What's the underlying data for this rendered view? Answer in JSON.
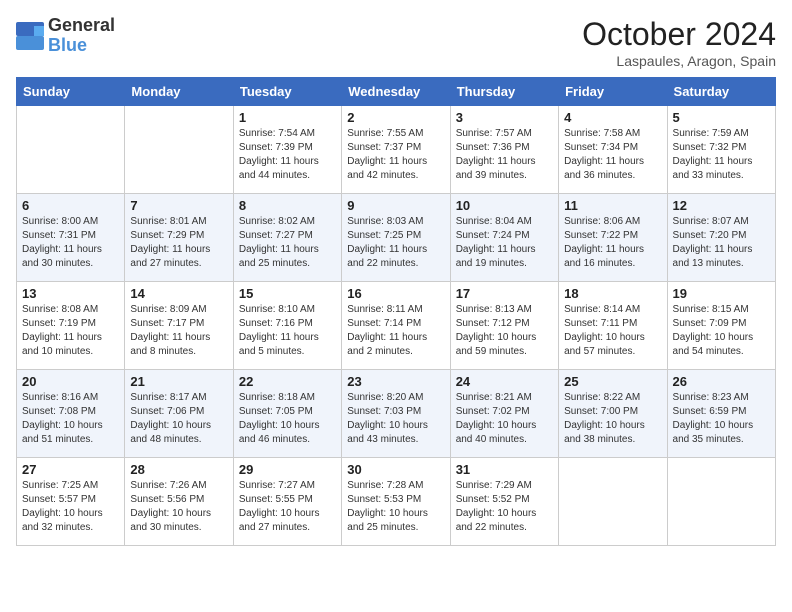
{
  "logo": {
    "general": "General",
    "blue": "Blue"
  },
  "title": "October 2024",
  "location": "Laspaules, Aragon, Spain",
  "days_header": [
    "Sunday",
    "Monday",
    "Tuesday",
    "Wednesday",
    "Thursday",
    "Friday",
    "Saturday"
  ],
  "weeks": [
    [
      {
        "day": "",
        "sunrise": "",
        "sunset": "",
        "daylight": ""
      },
      {
        "day": "",
        "sunrise": "",
        "sunset": "",
        "daylight": ""
      },
      {
        "day": "1",
        "sunrise": "Sunrise: 7:54 AM",
        "sunset": "Sunset: 7:39 PM",
        "daylight": "Daylight: 11 hours and 44 minutes."
      },
      {
        "day": "2",
        "sunrise": "Sunrise: 7:55 AM",
        "sunset": "Sunset: 7:37 PM",
        "daylight": "Daylight: 11 hours and 42 minutes."
      },
      {
        "day": "3",
        "sunrise": "Sunrise: 7:57 AM",
        "sunset": "Sunset: 7:36 PM",
        "daylight": "Daylight: 11 hours and 39 minutes."
      },
      {
        "day": "4",
        "sunrise": "Sunrise: 7:58 AM",
        "sunset": "Sunset: 7:34 PM",
        "daylight": "Daylight: 11 hours and 36 minutes."
      },
      {
        "day": "5",
        "sunrise": "Sunrise: 7:59 AM",
        "sunset": "Sunset: 7:32 PM",
        "daylight": "Daylight: 11 hours and 33 minutes."
      }
    ],
    [
      {
        "day": "6",
        "sunrise": "Sunrise: 8:00 AM",
        "sunset": "Sunset: 7:31 PM",
        "daylight": "Daylight: 11 hours and 30 minutes."
      },
      {
        "day": "7",
        "sunrise": "Sunrise: 8:01 AM",
        "sunset": "Sunset: 7:29 PM",
        "daylight": "Daylight: 11 hours and 27 minutes."
      },
      {
        "day": "8",
        "sunrise": "Sunrise: 8:02 AM",
        "sunset": "Sunset: 7:27 PM",
        "daylight": "Daylight: 11 hours and 25 minutes."
      },
      {
        "day": "9",
        "sunrise": "Sunrise: 8:03 AM",
        "sunset": "Sunset: 7:25 PM",
        "daylight": "Daylight: 11 hours and 22 minutes."
      },
      {
        "day": "10",
        "sunrise": "Sunrise: 8:04 AM",
        "sunset": "Sunset: 7:24 PM",
        "daylight": "Daylight: 11 hours and 19 minutes."
      },
      {
        "day": "11",
        "sunrise": "Sunrise: 8:06 AM",
        "sunset": "Sunset: 7:22 PM",
        "daylight": "Daylight: 11 hours and 16 minutes."
      },
      {
        "day": "12",
        "sunrise": "Sunrise: 8:07 AM",
        "sunset": "Sunset: 7:20 PM",
        "daylight": "Daylight: 11 hours and 13 minutes."
      }
    ],
    [
      {
        "day": "13",
        "sunrise": "Sunrise: 8:08 AM",
        "sunset": "Sunset: 7:19 PM",
        "daylight": "Daylight: 11 hours and 10 minutes."
      },
      {
        "day": "14",
        "sunrise": "Sunrise: 8:09 AM",
        "sunset": "Sunset: 7:17 PM",
        "daylight": "Daylight: 11 hours and 8 minutes."
      },
      {
        "day": "15",
        "sunrise": "Sunrise: 8:10 AM",
        "sunset": "Sunset: 7:16 PM",
        "daylight": "Daylight: 11 hours and 5 minutes."
      },
      {
        "day": "16",
        "sunrise": "Sunrise: 8:11 AM",
        "sunset": "Sunset: 7:14 PM",
        "daylight": "Daylight: 11 hours and 2 minutes."
      },
      {
        "day": "17",
        "sunrise": "Sunrise: 8:13 AM",
        "sunset": "Sunset: 7:12 PM",
        "daylight": "Daylight: 10 hours and 59 minutes."
      },
      {
        "day": "18",
        "sunrise": "Sunrise: 8:14 AM",
        "sunset": "Sunset: 7:11 PM",
        "daylight": "Daylight: 10 hours and 57 minutes."
      },
      {
        "day": "19",
        "sunrise": "Sunrise: 8:15 AM",
        "sunset": "Sunset: 7:09 PM",
        "daylight": "Daylight: 10 hours and 54 minutes."
      }
    ],
    [
      {
        "day": "20",
        "sunrise": "Sunrise: 8:16 AM",
        "sunset": "Sunset: 7:08 PM",
        "daylight": "Daylight: 10 hours and 51 minutes."
      },
      {
        "day": "21",
        "sunrise": "Sunrise: 8:17 AM",
        "sunset": "Sunset: 7:06 PM",
        "daylight": "Daylight: 10 hours and 48 minutes."
      },
      {
        "day": "22",
        "sunrise": "Sunrise: 8:18 AM",
        "sunset": "Sunset: 7:05 PM",
        "daylight": "Daylight: 10 hours and 46 minutes."
      },
      {
        "day": "23",
        "sunrise": "Sunrise: 8:20 AM",
        "sunset": "Sunset: 7:03 PM",
        "daylight": "Daylight: 10 hours and 43 minutes."
      },
      {
        "day": "24",
        "sunrise": "Sunrise: 8:21 AM",
        "sunset": "Sunset: 7:02 PM",
        "daylight": "Daylight: 10 hours and 40 minutes."
      },
      {
        "day": "25",
        "sunrise": "Sunrise: 8:22 AM",
        "sunset": "Sunset: 7:00 PM",
        "daylight": "Daylight: 10 hours and 38 minutes."
      },
      {
        "day": "26",
        "sunrise": "Sunrise: 8:23 AM",
        "sunset": "Sunset: 6:59 PM",
        "daylight": "Daylight: 10 hours and 35 minutes."
      }
    ],
    [
      {
        "day": "27",
        "sunrise": "Sunrise: 7:25 AM",
        "sunset": "Sunset: 5:57 PM",
        "daylight": "Daylight: 10 hours and 32 minutes."
      },
      {
        "day": "28",
        "sunrise": "Sunrise: 7:26 AM",
        "sunset": "Sunset: 5:56 PM",
        "daylight": "Daylight: 10 hours and 30 minutes."
      },
      {
        "day": "29",
        "sunrise": "Sunrise: 7:27 AM",
        "sunset": "Sunset: 5:55 PM",
        "daylight": "Daylight: 10 hours and 27 minutes."
      },
      {
        "day": "30",
        "sunrise": "Sunrise: 7:28 AM",
        "sunset": "Sunset: 5:53 PM",
        "daylight": "Daylight: 10 hours and 25 minutes."
      },
      {
        "day": "31",
        "sunrise": "Sunrise: 7:29 AM",
        "sunset": "Sunset: 5:52 PM",
        "daylight": "Daylight: 10 hours and 22 minutes."
      },
      {
        "day": "",
        "sunrise": "",
        "sunset": "",
        "daylight": ""
      },
      {
        "day": "",
        "sunrise": "",
        "sunset": "",
        "daylight": ""
      }
    ]
  ]
}
